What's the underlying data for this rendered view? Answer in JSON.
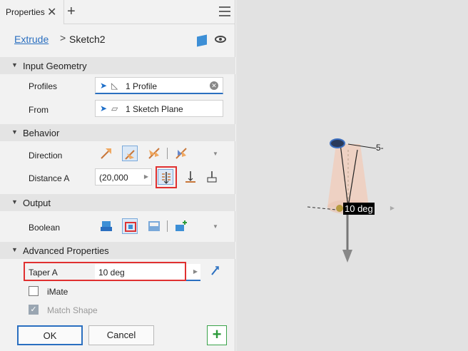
{
  "tab": {
    "label": "Properties",
    "close": "✕",
    "add": "+"
  },
  "breadcrumb": {
    "link": "Extrude",
    "sep": ">",
    "current": "Sketch2"
  },
  "sections": {
    "input_geometry": "Input Geometry",
    "behavior": "Behavior",
    "output": "Output",
    "advanced": "Advanced Properties"
  },
  "input_geometry": {
    "profiles_label": "Profiles",
    "profiles_value": "1 Profile",
    "from_label": "From",
    "from_value": "1 Sketch Plane"
  },
  "behavior": {
    "direction_label": "Direction",
    "distance_label": "Distance A",
    "distance_value": "(20,000"
  },
  "output": {
    "boolean_label": "Boolean"
  },
  "advanced": {
    "taper_label": "Taper A",
    "taper_value": "10 deg",
    "imate_label": "iMate",
    "match_shape_label": "Match Shape"
  },
  "footer": {
    "ok": "OK",
    "cancel": "Cancel"
  },
  "viewport": {
    "dimension_label": "10 deg",
    "five_label": "5-"
  },
  "colors": {
    "accent": "#2a6fc0",
    "highlight": "#e03030",
    "green": "#2d9b3b"
  }
}
